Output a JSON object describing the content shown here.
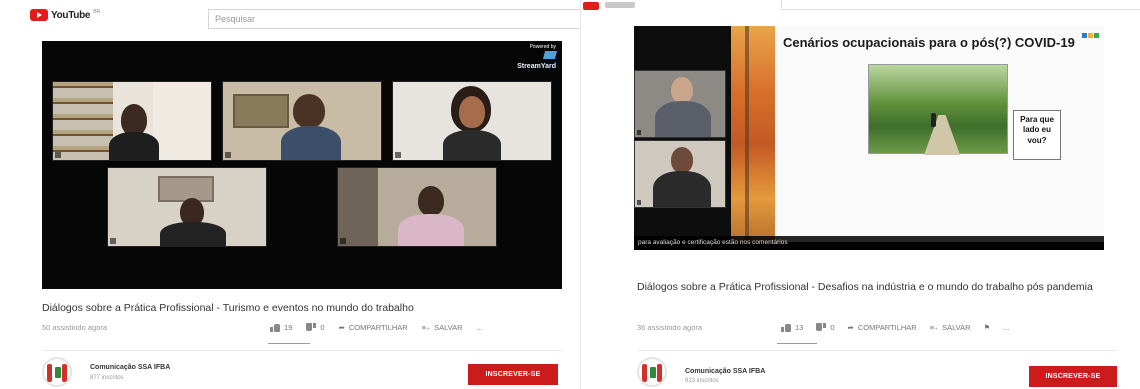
{
  "left": {
    "topbar": {
      "logo_text": "YouTube",
      "logo_sup": "BR",
      "search_placeholder": "Pesquisar"
    },
    "video": {
      "brand_line1": "Powered by",
      "brand_line2": "StreamYard",
      "participants": [
        "",
        "",
        "",
        "",
        ""
      ]
    },
    "title": "Diálogos sobre a Prática Profissional - Turismo e eventos no mundo do trabalho",
    "views": "50 assistindo agora",
    "actions": {
      "likes": "19",
      "dislikes": "0",
      "share": "COMPARTILHAR",
      "save": "SALVAR",
      "more": "..."
    },
    "channel": {
      "name": "Comunicação SSA IFBA",
      "subscribers": "877 inscritos",
      "subscribe": "INSCREVER-SE"
    }
  },
  "right": {
    "slide": {
      "title": "Cenários ocupacionais para o pós(?) COVID-19",
      "bubble": "Para que lado eu vou?"
    },
    "caption": "para avaliação e certificação estão nos comentários",
    "title": "Diálogos sobre a Prática Profissional - Desafios na indústria e o mundo do trabalho pós pandemia",
    "views": "36 assistindo agora",
    "actions": {
      "likes": "13",
      "dislikes": "0",
      "share": "COMPARTILHAR",
      "save": "SALVAR",
      "more": "..."
    },
    "channel": {
      "name": "Comunicação SSA IFBA",
      "subscribers": "913 inscritos",
      "subscribe": "INSCREVER-SE"
    }
  },
  "colors": {
    "brand_red": "#cc1b1b",
    "video_bg": "#060606",
    "text_muted": "#8a8a8a"
  }
}
